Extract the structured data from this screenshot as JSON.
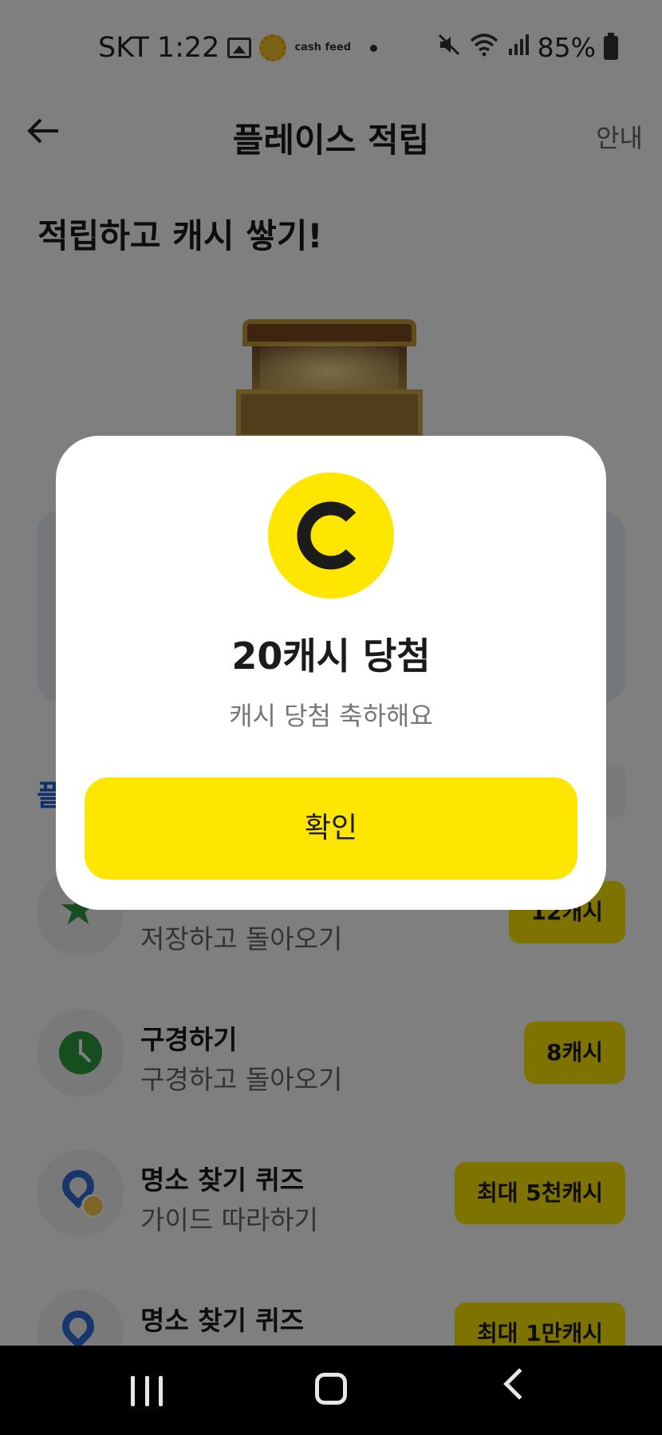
{
  "status_bar": {
    "carrier": "SKT",
    "time": "1:22",
    "battery": "85%",
    "icons": [
      "gallery-icon",
      "sun-icon",
      "cashfeed-icon",
      "dot-icon",
      "mute-icon",
      "wifi-icon",
      "signal-icon",
      "battery-icon"
    ]
  },
  "cashfeed_icon_text": "cash feed",
  "appbar": {
    "title": "플레이스 적립",
    "guide_label": "안내"
  },
  "headline": "적립하고 캐시 쌓기!",
  "section_label": "플",
  "missions": [
    {
      "title": "",
      "subtitle": "저장하고 돌아오기",
      "reward": "12캐시",
      "icon": "star-icon"
    },
    {
      "title": "구경하기",
      "subtitle": "구경하고 돌아오기",
      "reward": "8캐시",
      "icon": "clock-icon"
    },
    {
      "title": "명소 찾기 퀴즈",
      "subtitle": "가이드 따라하기",
      "reward": "최대 5천캐시",
      "icon": "location-pin-smile-icon"
    },
    {
      "title": "명소 찾기 퀴즈",
      "subtitle": "",
      "reward": "최대 1만캐시",
      "icon": "location-pin-icon"
    }
  ],
  "modal": {
    "coin_letter": "C",
    "title": "20캐시 당첨",
    "message": "캐시 당첨 축하해요",
    "confirm_label": "확인",
    "accent_color": "#FFE600"
  },
  "colors": {
    "accent": "#FFE600",
    "section_blue": "#1D5FD6",
    "icon_green": "#2F9C3E",
    "overlay": "rgba(0,0,0,0.5)"
  }
}
